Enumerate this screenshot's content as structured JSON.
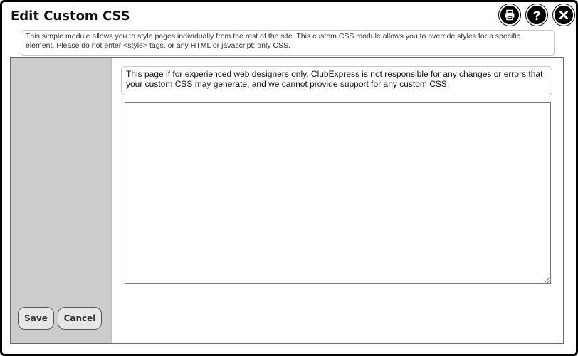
{
  "dialog": {
    "title": "Edit Custom CSS",
    "description": "This simple module allows you to style pages individually from the rest of the site. This custom CSS module allows you to override styles for a specific element. Please do not enter <style> tags, or any HTML or javascript; only CSS."
  },
  "title_icons": [
    {
      "name": "print-icon"
    },
    {
      "name": "help-icon"
    },
    {
      "name": "close-icon"
    }
  ],
  "main": {
    "warning": "This page if for experienced web designers only. ClubExpress is not responsible for any changes or errors that your custom CSS may generate, and we cannot provide support for any custom CSS.",
    "editor_value": ""
  },
  "sidebar": {
    "save_label": "Save",
    "cancel_label": "Cancel"
  },
  "colors": {
    "sidebar_bg": "#cccccc",
    "frame_border": "#000000",
    "button_bg": "#e6e6e6"
  }
}
